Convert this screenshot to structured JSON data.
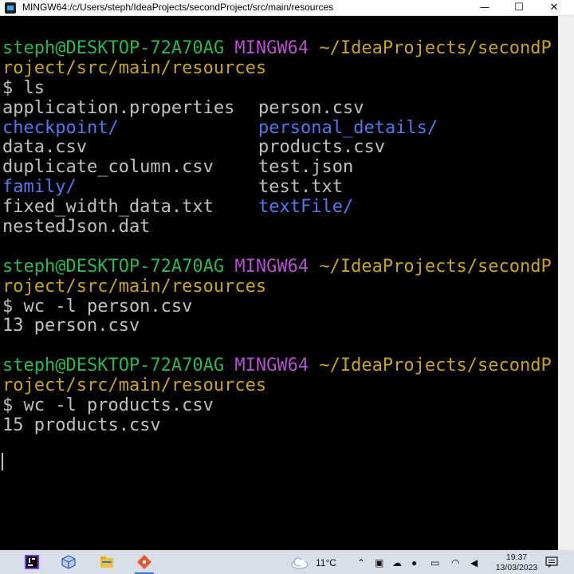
{
  "window": {
    "title": "MINGW64:/c/Users/steph/IdeaProjects/secondProject/src/main/resources",
    "minimize": "—",
    "maximize": "☐",
    "close": "✕"
  },
  "terminal": {
    "prompt_blocks": [
      {
        "user": "steph@DESKTOP-72A70AG",
        "shell": "MINGW64",
        "path_part1": "~/IdeaProjects/secondP",
        "path_part2": "roject/src/main/resources",
        "command": "$ ls"
      },
      {
        "user": "steph@DESKTOP-72A70AG",
        "shell": "MINGW64",
        "path_part1": "~/IdeaProjects/secondP",
        "path_part2": "roject/src/main/resources",
        "command": "$ wc -l person.csv",
        "output": "13 person.csv"
      },
      {
        "user": "steph@DESKTOP-72A70AG",
        "shell": "MINGW64",
        "path_part1": "~/IdeaProjects/secondP",
        "path_part2": "roject/src/main/resources",
        "command": "$ wc -l products.csv",
        "output": "15 products.csv"
      }
    ],
    "ls_rows": [
      {
        "left": "application.properties",
        "left_dir": false,
        "right": "person.csv",
        "right_dir": false
      },
      {
        "left": "checkpoint/",
        "left_dir": true,
        "right": "personal_details/",
        "right_dir": true
      },
      {
        "left": "data.csv",
        "left_dir": false,
        "right": "products.csv",
        "right_dir": false
      },
      {
        "left": "duplicate_column.csv",
        "left_dir": false,
        "right": "test.json",
        "right_dir": false
      },
      {
        "left": "family/",
        "left_dir": true,
        "right": "test.txt",
        "right_dir": false
      },
      {
        "left": "fixed_width_data.txt",
        "left_dir": false,
        "right": "textFile/",
        "right_dir": true
      },
      {
        "left": "nestedJson.dat",
        "left_dir": false,
        "right": "",
        "right_dir": false
      }
    ]
  },
  "taskbar": {
    "apps": [
      "intellij-icon",
      "virtualbox-icon",
      "file-explorer-icon",
      "git-bash-icon"
    ],
    "weather_icon": "cloud-icon",
    "temperature": "11°C",
    "tray_icons": [
      "chevron-up-icon",
      "network-icon",
      "onedrive-icon",
      "microphone-icon",
      "wifi-icon",
      "volume-icon",
      "keyboard-icon"
    ],
    "time": "19:37",
    "date": "13/03/2023",
    "notifications_icon": "notification-icon"
  },
  "colors": {
    "user": "#28b84f",
    "shell": "#b84fcf",
    "path": "#c8a51e",
    "directory": "#5577ee",
    "text": "#c0c0c0"
  }
}
